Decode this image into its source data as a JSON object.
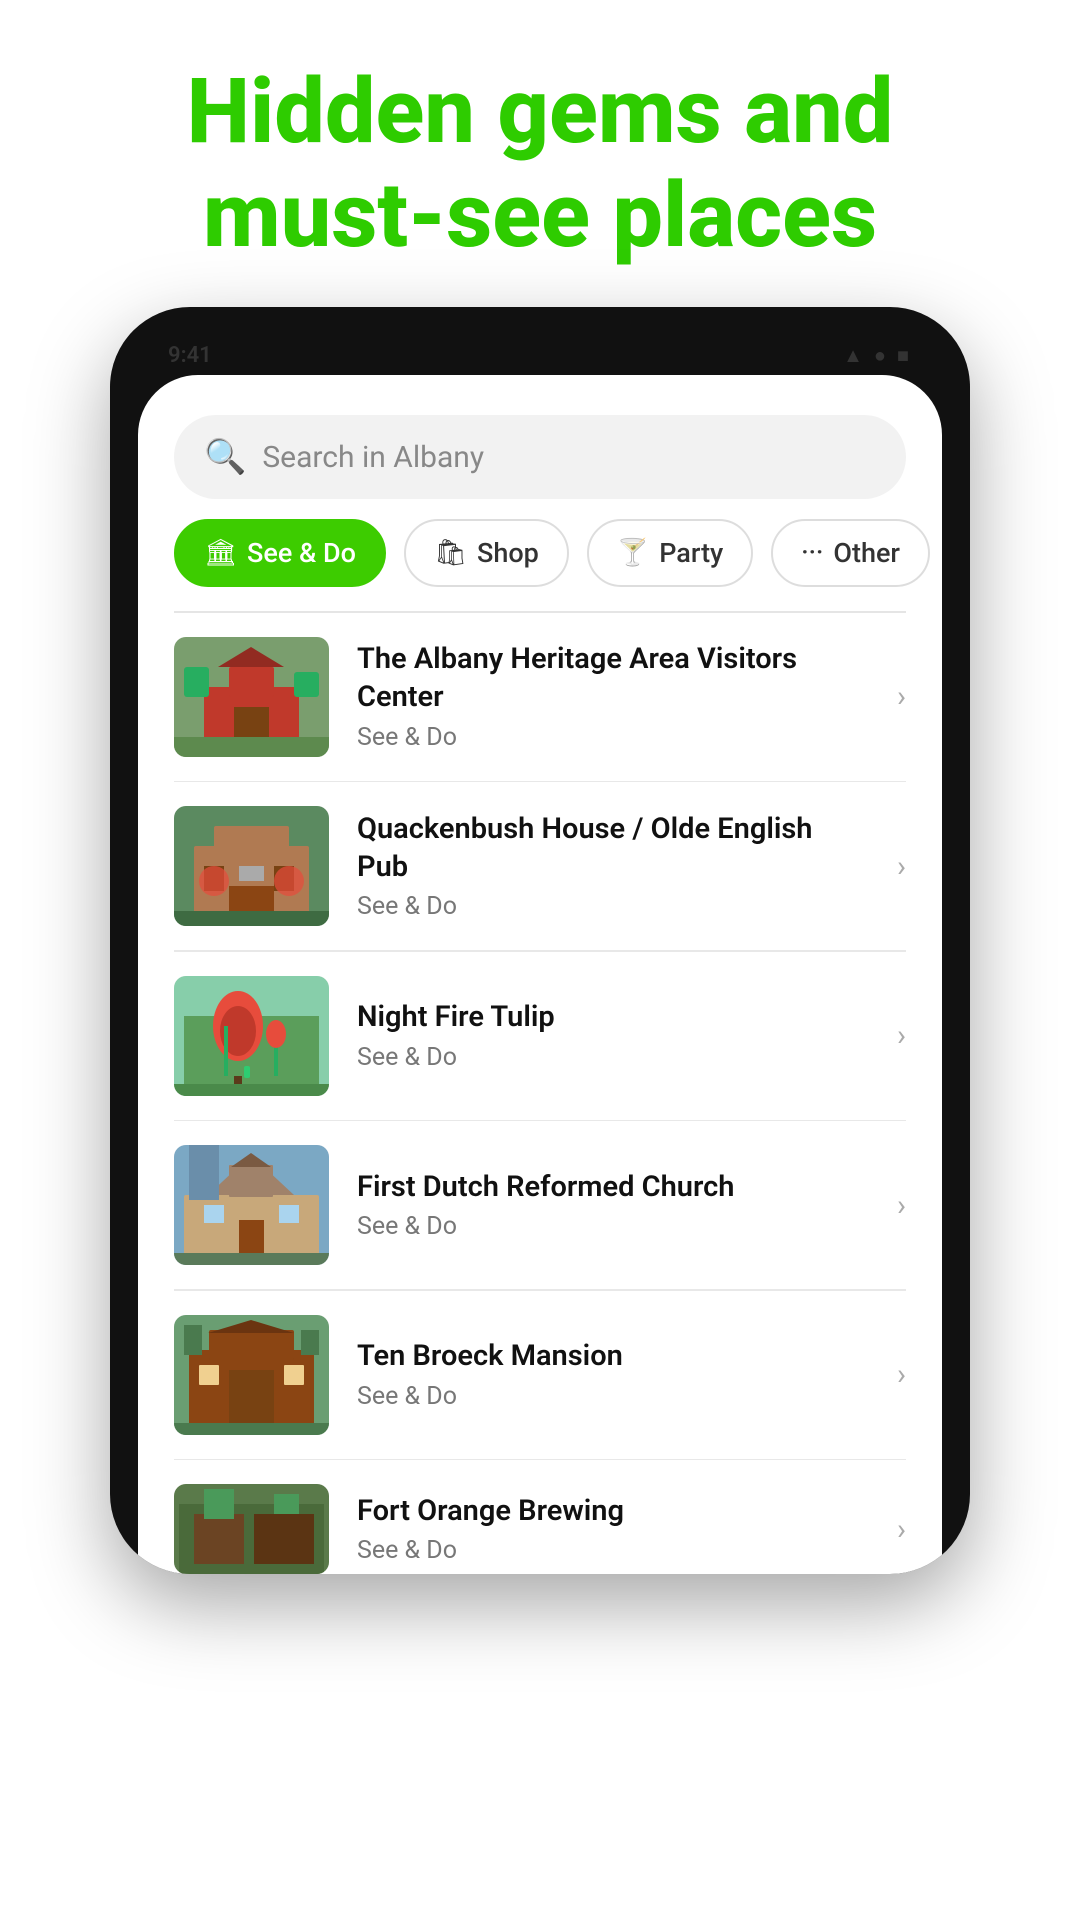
{
  "headline": {
    "line1": "Hidden gems and",
    "line2": "must-see places"
  },
  "search": {
    "placeholder": "Search in Albany"
  },
  "filters": [
    {
      "id": "see-do",
      "label": "See & Do",
      "icon": "🏛",
      "active": true
    },
    {
      "id": "shop",
      "label": "Shop",
      "icon": "🛍",
      "active": false
    },
    {
      "id": "party",
      "label": "Party",
      "icon": "🍸",
      "active": false
    },
    {
      "id": "other",
      "label": "Other",
      "icon": "···",
      "active": false
    }
  ],
  "places": [
    {
      "id": 1,
      "name": "The Albany Heritage Area Visitors Center",
      "category": "See & Do",
      "thumbColor": "#7a9e6e"
    },
    {
      "id": 2,
      "name": "Quackenbush House / Olde English Pub",
      "category": "See & Do",
      "thumbColor": "#b07a52"
    },
    {
      "id": 3,
      "name": "Night Fire Tulip",
      "category": "See & Do",
      "thumbColor": "#6a9e72"
    },
    {
      "id": 4,
      "name": "First Dutch Reformed Church",
      "category": "See & Do",
      "thumbColor": "#8fa8c4"
    },
    {
      "id": 5,
      "name": "Ten Broeck Mansion",
      "category": "See & Do",
      "thumbColor": "#7a6e5e"
    },
    {
      "id": 6,
      "name": "Fort Orange Brewing",
      "category": "See & Do",
      "thumbColor": "#6e8a5e"
    }
  ],
  "colors": {
    "accent": "#3dcc00",
    "text_primary": "#111111",
    "text_secondary": "#777777"
  }
}
